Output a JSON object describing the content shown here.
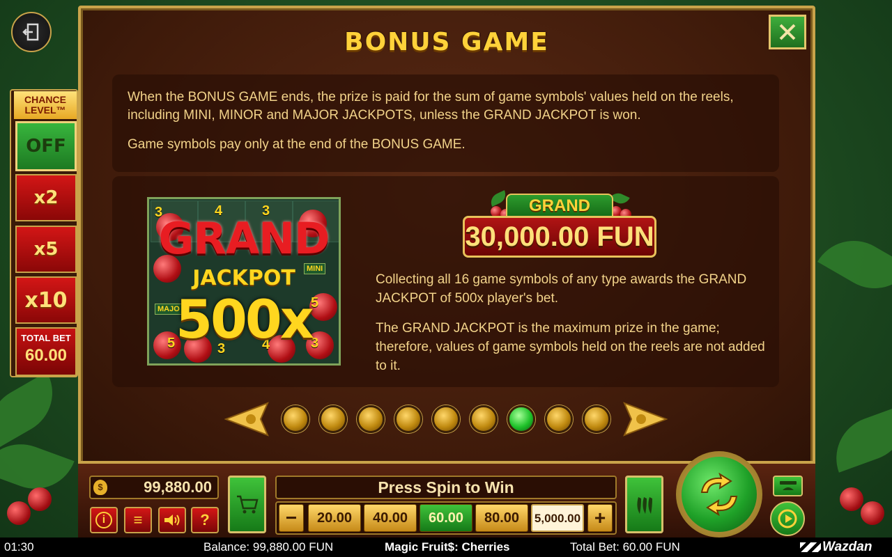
{
  "title": "BONUS GAME",
  "paragraphs": {
    "p1": "When the BONUS GAME ends, the prize is paid for the sum of game symbols' values held on the reels, including MINI, MINOR and MAJOR JACKPOTS, unless the GRAND JACKPOT is won.",
    "p2": "Game symbols pay only at the end of the BONUS GAME."
  },
  "jackpot_image": {
    "line1": "GRAND",
    "line2": "JACKPOT",
    "line3": "500x",
    "tags": {
      "mini": "MINI",
      "major": "MAJO"
    },
    "numbers": {
      "n1": "3",
      "n2": "5",
      "n3": "5",
      "n4": "3",
      "n5": "4",
      "n6": "3",
      "n7": "3",
      "n8": "4"
    }
  },
  "grand_plaque": {
    "label": "GRAND",
    "amount": "30,000.00 FUN"
  },
  "descriptions": {
    "d1": "Collecting all 16 game symbols of any type awards the GRAND JACKPOT of 500x player's bet.",
    "d2": "The GRAND JACKPOT is the maximum prize in the game; therefore, values of game symbols held on the reels are not added to it."
  },
  "pagination": {
    "total": 9,
    "active_index": 6
  },
  "chance_level": {
    "title": "CHANCE LEVEL™",
    "options": [
      "OFF",
      "x2",
      "x5",
      "x10"
    ],
    "selected": "OFF",
    "total_bet_label": "TOTAL BET",
    "total_bet_value": "60.00"
  },
  "bottom": {
    "balance": "99,880.00",
    "money_symbol": "$",
    "message": "Press Spin to Win",
    "bets": [
      "20.00",
      "40.00",
      "60.00",
      "80.00",
      "5,000.00"
    ],
    "active_bet": "60.00",
    "minus": "−",
    "plus": "+",
    "info_label": "i",
    "menu_label": "≡",
    "sound_label": "🔊",
    "help_label": "?"
  },
  "status_bar": {
    "time": "01:30",
    "balance": "Balance: 99,880.00 FUN",
    "game_name": "Magic Fruit$: Cherries",
    "total_bet": "Total Bet: 60.00 FUN",
    "brand": "Wazdan"
  },
  "colors": {
    "gold": "#ffd23a",
    "panel_border": "#c9a34a",
    "green_active": "#1fc22a",
    "red": "#c71212"
  },
  "icons": {
    "exit": "exit-door-icon",
    "close": "close-x-icon",
    "cart": "shopping-cart-icon",
    "pepper": "chili-pepper-icon",
    "spin": "spin-arrows-icon",
    "autoplay": "autoplay-icon",
    "turbo": "turbo-icon",
    "prev": "arrow-left-icon",
    "next": "arrow-right-icon"
  }
}
